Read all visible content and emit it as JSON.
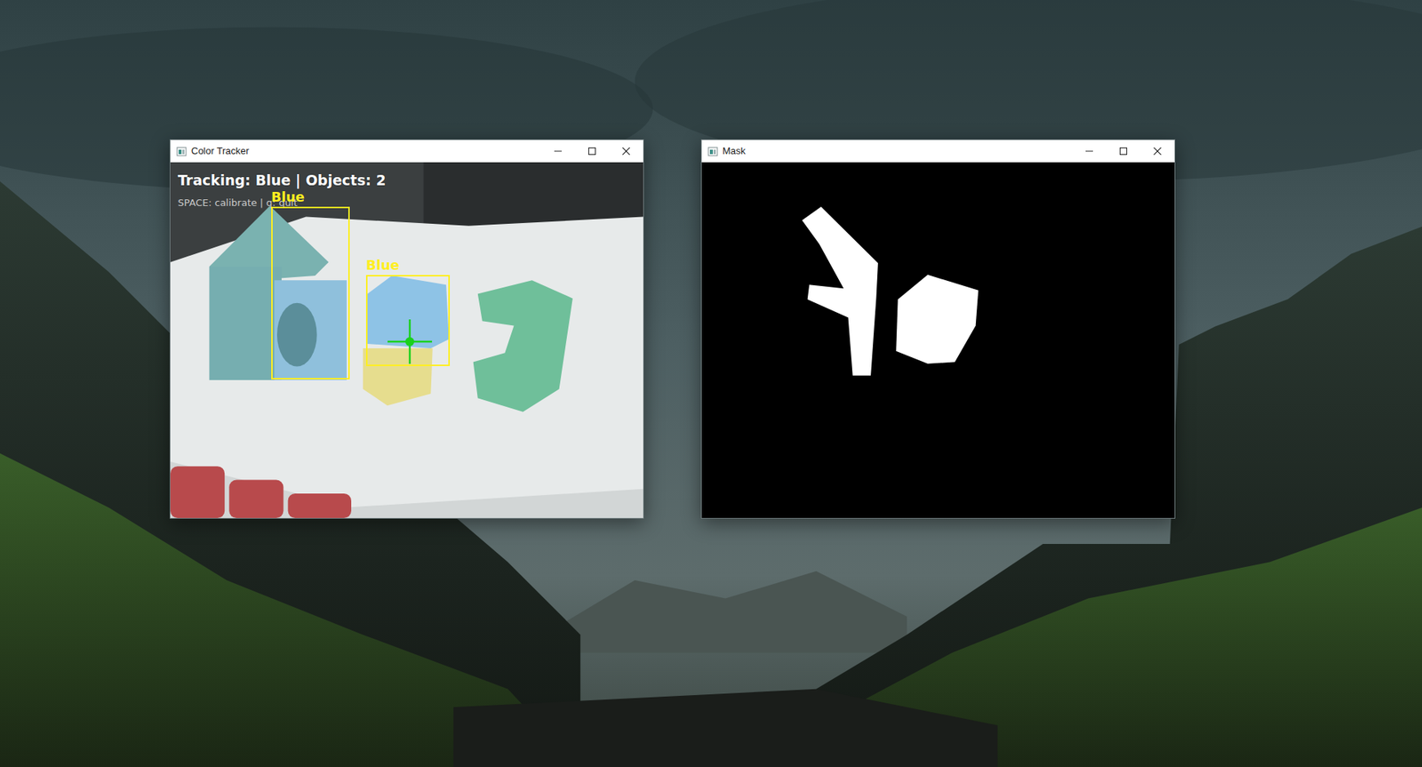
{
  "windows": [
    {
      "title": "Color Tracker",
      "kind": "camera",
      "overlay": {
        "status": "Tracking: Blue | Objects: 2",
        "hint": "SPACE: calibrate | q: quit"
      },
      "detections": [
        {
          "label": "Blue",
          "selected": false
        },
        {
          "label": "Blue",
          "selected": true
        }
      ]
    },
    {
      "title": "Mask",
      "kind": "mask"
    }
  ]
}
